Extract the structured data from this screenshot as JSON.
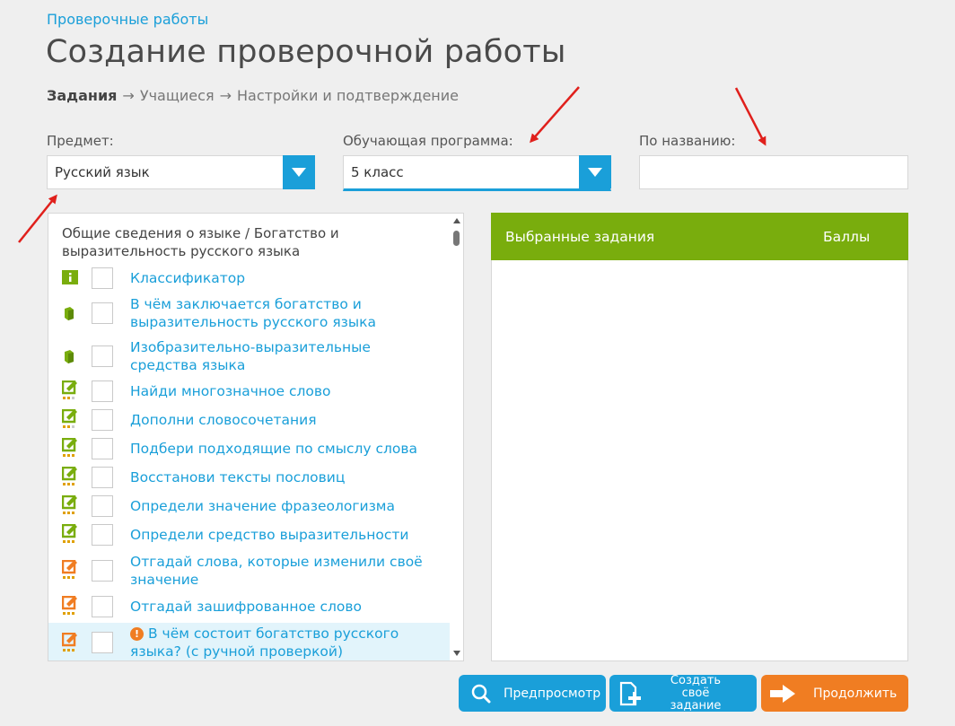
{
  "breadcrumb": "Проверочные работы",
  "title": "Создание проверочной работы",
  "steps": {
    "step1": "Задания",
    "step2": "Учащиеся",
    "step3": "Настройки и подтверждение",
    "separator": "→"
  },
  "filters": {
    "subject_label": "Предмет:",
    "subject_value": "Русский язык",
    "program_label": "Обучающая программа:",
    "program_value": "5 класс",
    "name_label": "По названию:",
    "name_value": ""
  },
  "task_list": {
    "group_title": "Общие сведения о языке / Богатство и выразительность русского языка",
    "items": [
      {
        "label": "Классификатор",
        "icon": "info-icon"
      },
      {
        "label": "В чём заключается богатство и выразительность русского языка",
        "icon": "book-icon"
      },
      {
        "label": "Изобразительно-выразительные средства языка",
        "icon": "book-icon"
      },
      {
        "label": "Найди многозначное слово",
        "icon": "task-green-icon"
      },
      {
        "label": "Дополни словосочетания",
        "icon": "task-green-icon"
      },
      {
        "label": "Подбери подходящие по смыслу слова",
        "icon": "task-green-icon"
      },
      {
        "label": "Восстанови тексты пословиц",
        "icon": "task-green-icon"
      },
      {
        "label": "Определи значение фразеологизма",
        "icon": "task-green-icon"
      },
      {
        "label": "Определи средство выразительности",
        "icon": "task-green-icon"
      },
      {
        "label": "Отгадай слова, которые изменили своё значение",
        "icon": "task-orange-icon"
      },
      {
        "label": "Отгадай зашифрованное слово",
        "icon": "task-orange-icon"
      },
      {
        "label": "В чём состоит богатство русского языка? (с ручной проверкой)",
        "icon": "task-orange-icon"
      }
    ]
  },
  "selected": {
    "header_tasks": "Выбранные задания",
    "header_points": "Баллы"
  },
  "buttons": {
    "preview": "Предпросмотр",
    "create_own": "Создать своё задание",
    "continue": "Продолжить"
  },
  "colors": {
    "accent_blue": "#1a9fd9",
    "green": "#79ad0d",
    "orange": "#f07d22",
    "annotation_red": "#e0201c"
  }
}
